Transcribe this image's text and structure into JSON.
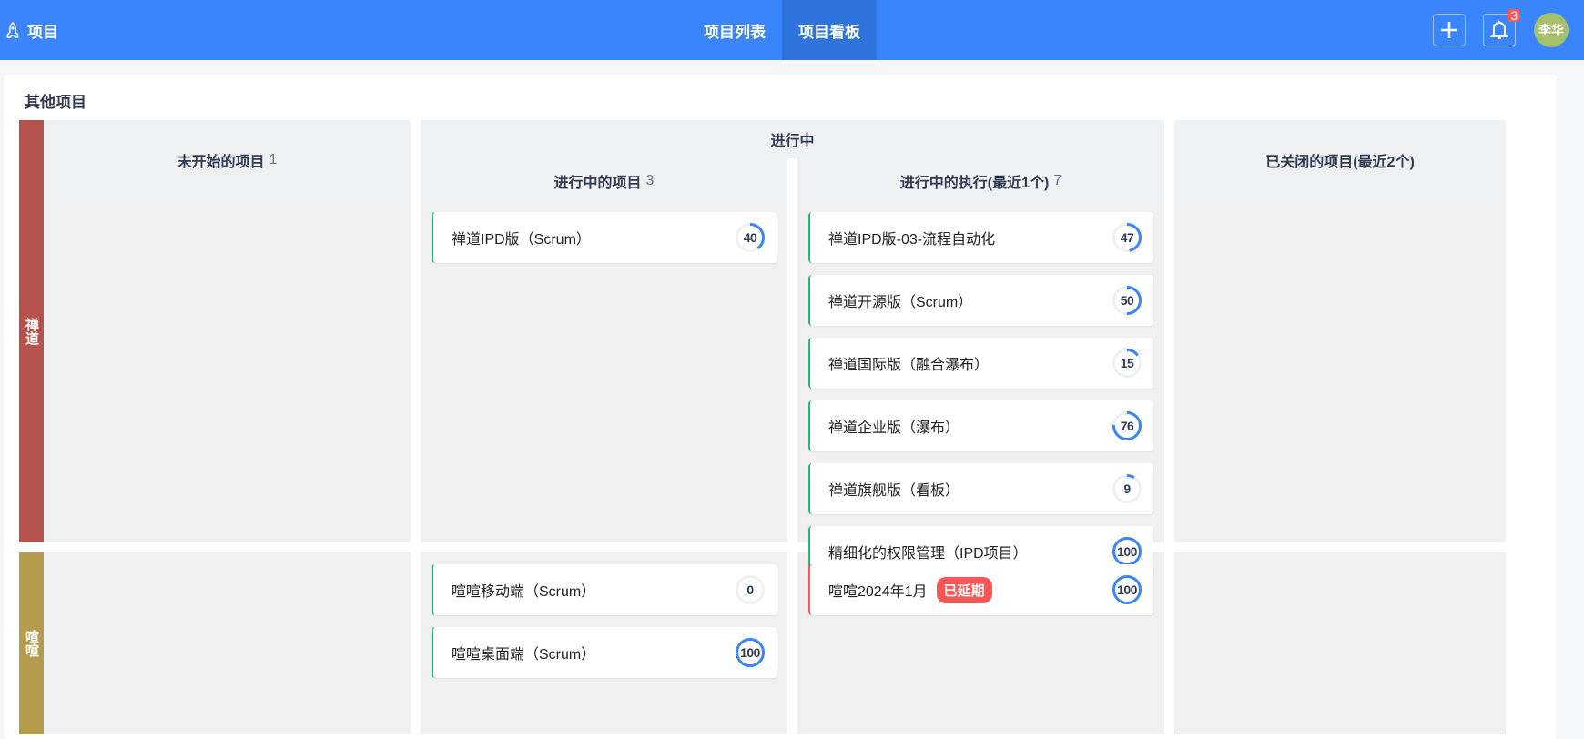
{
  "header": {
    "brand": "项目",
    "tabs": [
      {
        "label": "项目列表"
      },
      {
        "label": "项目看板"
      }
    ],
    "notifications": "3",
    "user": "李华"
  },
  "board": {
    "title": "其他项目",
    "columns": {
      "waiting": {
        "label": "未开始的项目",
        "count": "1"
      },
      "doing": {
        "label": "进行中"
      },
      "doing_projects": {
        "label": "进行中的项目",
        "count": "3"
      },
      "doing_executions": {
        "label": "进行中的执行(最近1个)",
        "count": "7"
      },
      "closed": {
        "label": "已关闭的项目(最近2个)"
      }
    },
    "groups": [
      {
        "name": "禅道",
        "color": "#b5524c",
        "projects": [
          {
            "name": "禅道IPD版（Scrum）",
            "progress": 40
          }
        ],
        "executions": [
          {
            "name": "禅道IPD版-03-流程自动化",
            "progress": 47
          },
          {
            "name": "禅道开源版（Scrum）",
            "progress": 50
          },
          {
            "name": "禅道国际版（融合瀑布）",
            "progress": 15
          },
          {
            "name": "禅道企业版（瀑布）",
            "progress": 76
          },
          {
            "name": "禅道旗舰版（看板）",
            "progress": 9
          },
          {
            "name": "精细化的权限管理（IPD项目）",
            "progress": 100
          }
        ]
      },
      {
        "name": "喧喧",
        "color": "#b79b4c",
        "projects": [
          {
            "name": "喧喧移动端（Scrum）",
            "progress": 0
          },
          {
            "name": "喧喧桌面端（Scrum）",
            "progress": 100
          }
        ],
        "executions": [
          {
            "name": "喧喧2024年1月",
            "tag": "已延期",
            "progress": 100
          }
        ]
      }
    ]
  },
  "colors": {
    "header": "#3a85fb",
    "ring": "#3a85fb",
    "delay": "#ff5555",
    "ok": "#2ab57d"
  }
}
